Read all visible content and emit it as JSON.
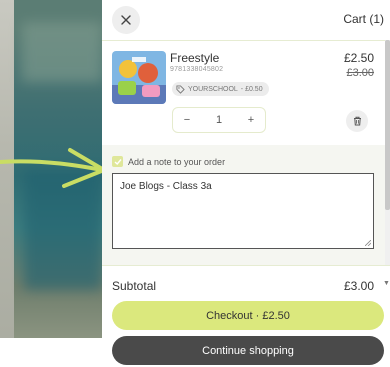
{
  "header": {
    "cart_title": "Cart (1)",
    "close_icon": "close-icon"
  },
  "item": {
    "title": "Freestyle",
    "isbn": "9781338045802",
    "price": "£2.50",
    "original_price": "£3.00",
    "discount": {
      "icon": "tag-icon",
      "code": "YOURSCHOOL",
      "amount": "- £0.50"
    },
    "quantity": "1",
    "decrease_label": "−",
    "increase_label": "+",
    "remove_icon": "trash-icon"
  },
  "note": {
    "checked": true,
    "label": "Add a note to your order",
    "value": "Joe Blogs - Class 3a"
  },
  "footer": {
    "subtotal_label": "Subtotal",
    "subtotal_value": "£3.00",
    "checkout_label": "Checkout · £2.50",
    "continue_label": "Continue shopping"
  },
  "colors": {
    "accent": "#dbe87d",
    "dark_button": "#4a4a4a",
    "annotation_arrow": "#c9dd64"
  }
}
